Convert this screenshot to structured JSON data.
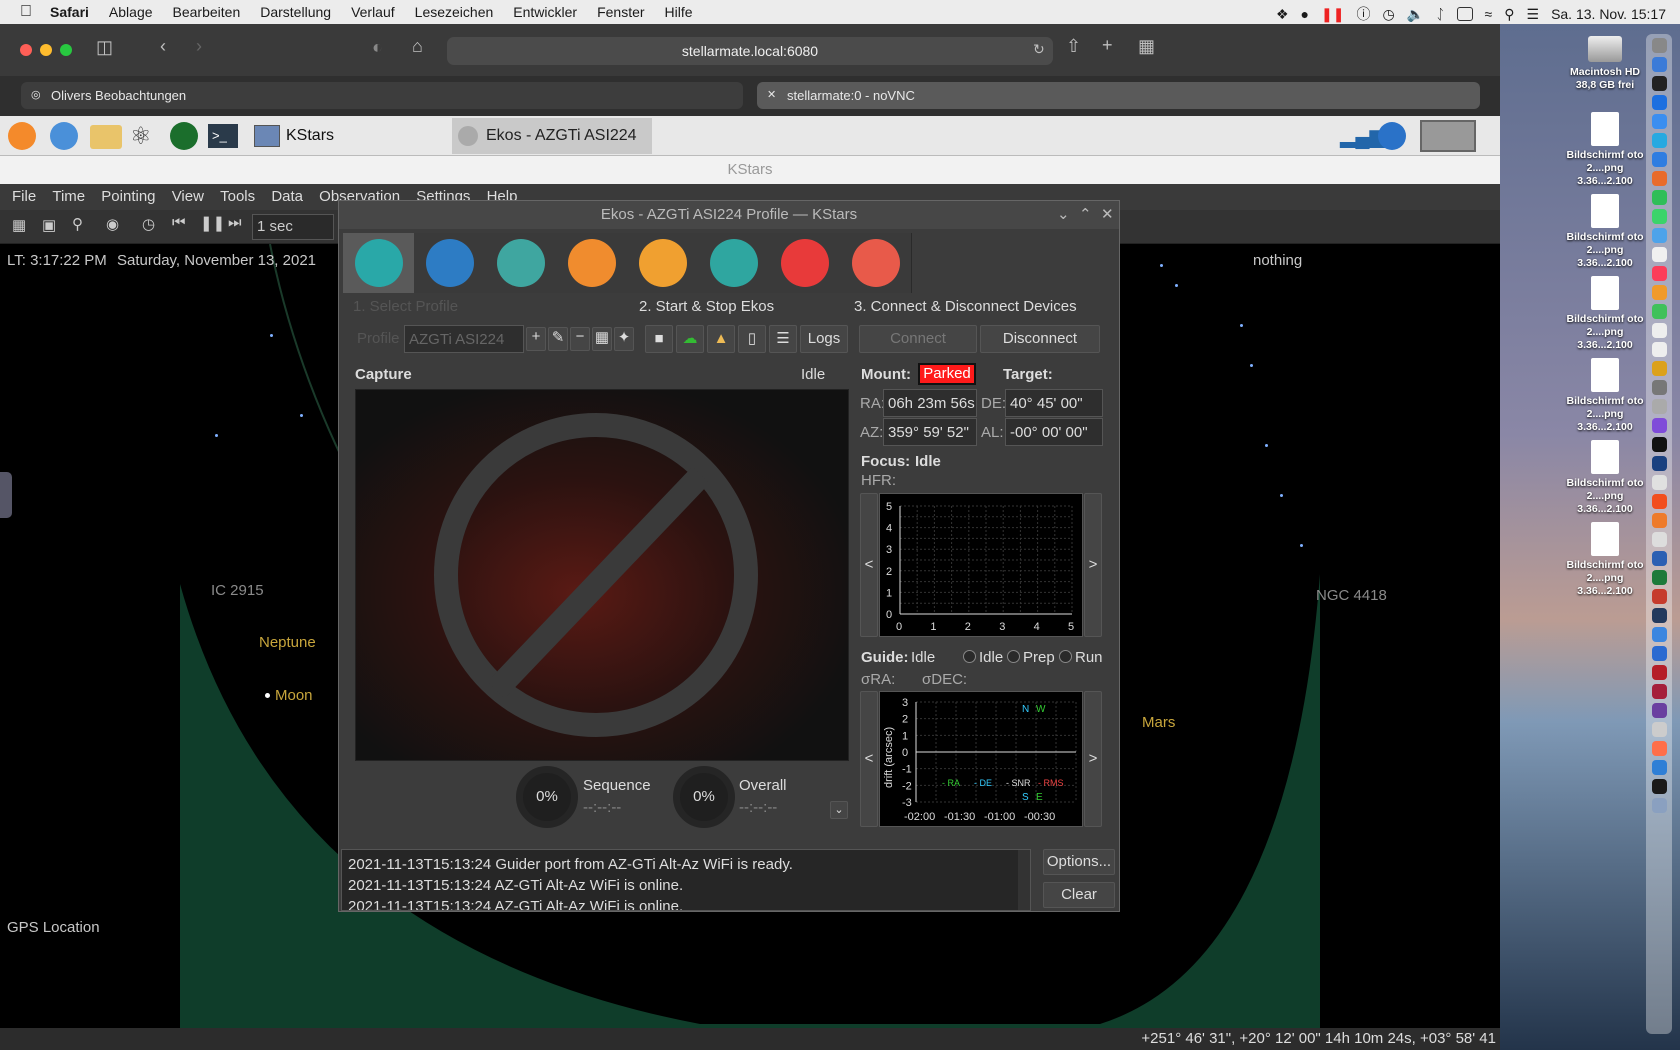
{
  "macos": {
    "menubar": {
      "app_name": "Safari",
      "menus": [
        "Ablage",
        "Bearbeiten",
        "Darstellung",
        "Verlauf",
        "Lesezeichen",
        "Entwickler",
        "Fenster",
        "Hilfe"
      ],
      "clock": "Sa. 13. Nov.  15:17"
    },
    "desktop": {
      "disk": {
        "name": "Macintosh HD",
        "free": "38,8 GB frei"
      },
      "files": [
        {
          "name": "Bildschirmf oto 2....png",
          "sub": "3.36...2.100"
        },
        {
          "name": "Bildschirmf oto 2....png",
          "sub": "3.36...2.100"
        },
        {
          "name": "Bildschirmf oto 2....png",
          "sub": "3.36...2.100"
        },
        {
          "name": "Bildschirmf oto 2....png",
          "sub": "3.36...2.100"
        },
        {
          "name": "Bildschirmf oto 2....png",
          "sub": "3.36...2.100"
        },
        {
          "name": "Bildschirmf oto 2....png",
          "sub": "3.36...2.100"
        }
      ]
    }
  },
  "safari": {
    "url": "stellarmate.local:6080",
    "tabs": [
      {
        "label": "Olivers Beobachtungen"
      },
      {
        "label": "stellarmate:0 - noVNC"
      }
    ]
  },
  "lxpanel": {
    "tasks": [
      "KStars",
      "Ekos - AZGTi ASI224 ..."
    ]
  },
  "kstars": {
    "window_title": "KStars",
    "menus": [
      "File",
      "Time",
      "Pointing",
      "View",
      "Tools",
      "Data",
      "Observation",
      "Settings",
      "Help"
    ],
    "time_step": "1 sec",
    "lt": "LT: 3:17:22 PM",
    "date": "Saturday, November 13, 2021",
    "focus_obj": "nothing",
    "sky_labels": {
      "ic": "IC 2915",
      "neptune": "Neptune",
      "moon": "Moon",
      "ngc": "NGC 4418",
      "mars": "Mars",
      "gps": "GPS Location"
    },
    "status_coords": "+251° 46' 31\", +20° 12' 00\"  14h 10m 24s, +03° 58' 41"
  },
  "ekos": {
    "title": "Ekos - AZGTi ASI224 Profile — KStars",
    "sections": {
      "select_profile": "1. Select Profile",
      "start_stop": "2. Start & Stop Ekos",
      "connect": "3. Connect & Disconnect Devices"
    },
    "profile_label": "Profile",
    "profile_value": "AZGTi ASI224",
    "logs_btn": "Logs",
    "connect_btn": "Connect",
    "disconnect_btn": "Disconnect",
    "capture": {
      "label": "Capture",
      "status": "Idle"
    },
    "mount": {
      "label": "Mount:",
      "status": "Parked",
      "target_label": "Target:",
      "ra_label": "RA:",
      "ra": "06h 23m 56s",
      "de_label": "DE:",
      "de": "40° 45' 00\"",
      "az_label": "AZ:",
      "az": "359° 59' 52\"",
      "al_label": "AL:",
      "al": "-00° 00' 00\""
    },
    "focus": {
      "label": "Focus:",
      "status": "Idle",
      "hfr": "HFR:",
      "x_ticks": [
        "0",
        "1",
        "2",
        "3",
        "4",
        "5"
      ],
      "y_ticks": [
        "5",
        "4",
        "3",
        "2",
        "1",
        "0"
      ]
    },
    "guide": {
      "label": "Guide:",
      "status": "Idle",
      "radio": [
        "Idle",
        "Prep",
        "Run"
      ],
      "sra": "σRA:",
      "sdec": "σDEC:",
      "ylabel": "drift (arcsec)",
      "y_ticks": [
        "3",
        "2",
        "1",
        "0",
        "-1",
        "-2",
        "-3"
      ],
      "x_ticks": [
        "-02:00",
        "-01:30",
        "-01:00",
        "-00:30"
      ],
      "legend": [
        "RA",
        "DE",
        "SNR",
        "RMS"
      ],
      "compass": {
        "n": "N",
        "w": "W",
        "s": "S",
        "e": "E"
      }
    },
    "progress": {
      "sequence_pct": "0%",
      "sequence_label": "Sequence",
      "sequence_time": "--:--:--",
      "overall_pct": "0%",
      "overall_label": "Overall",
      "overall_time": "--:--:--"
    },
    "log_lines": [
      "2021-11-13T15:13:24 Guider port from AZ-GTi Alt-Az WiFi is ready.",
      "2021-11-13T15:13:24 AZ-GTi Alt-Az WiFi is online.",
      "2021-11-13T15:13:24 AZ-GTi Alt-Az WiFi is online."
    ],
    "options_btn": "Options...",
    "clear_btn": "Clear"
  },
  "colors": {
    "parked_bg": "#ff1a1a",
    "sky_horizon": "#0f3d2a"
  }
}
